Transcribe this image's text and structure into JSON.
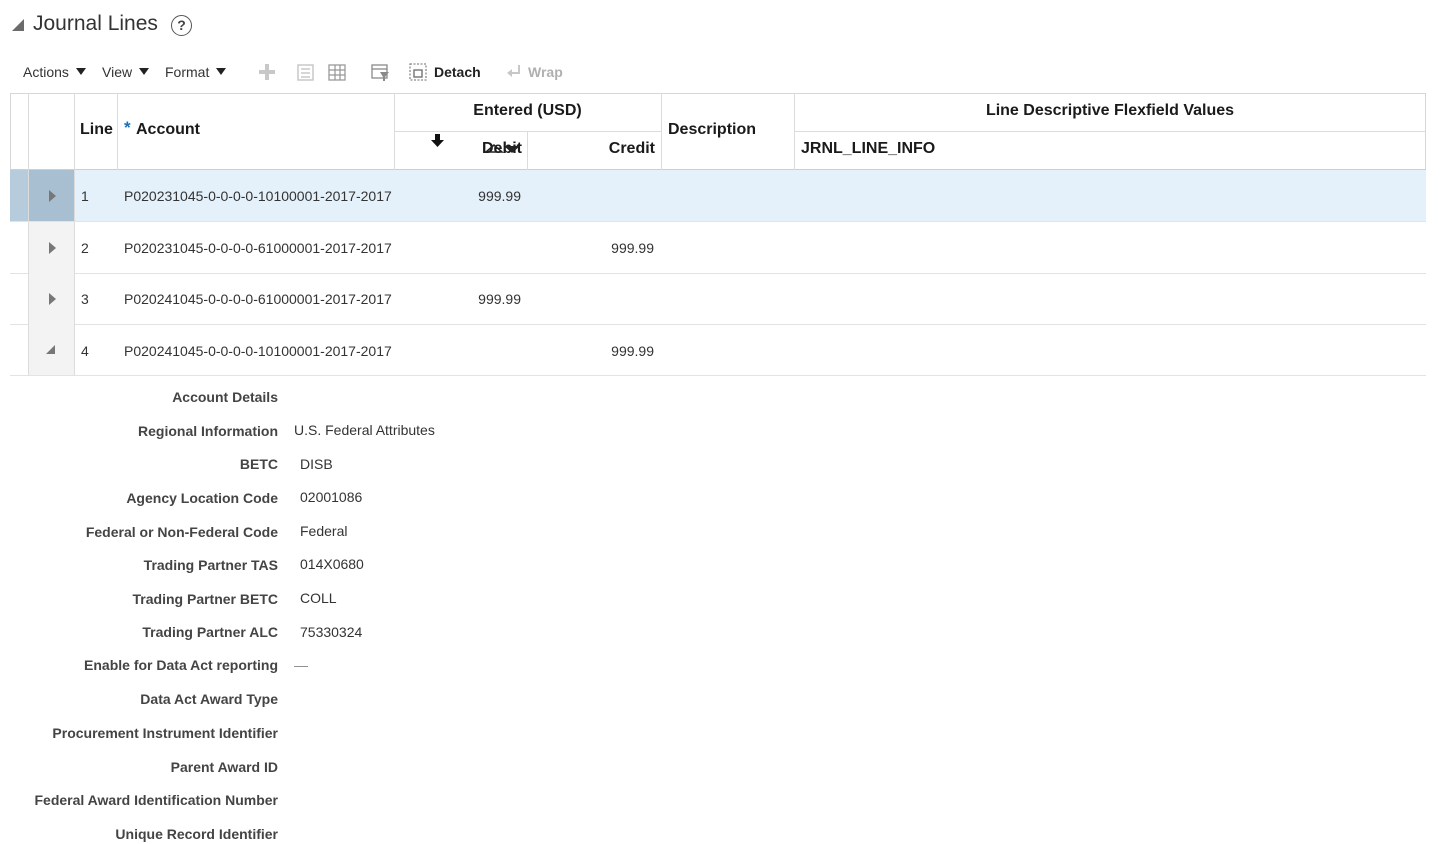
{
  "section": {
    "title": "Journal Lines",
    "help_symbol": "?"
  },
  "toolbar": {
    "actions_label": "Actions",
    "view_label": "View",
    "format_label": "Format",
    "detach_label": "Detach",
    "wrap_label": "Wrap"
  },
  "columns": {
    "line": "Line",
    "account_required_marker": "*",
    "account": "Account",
    "entered_group": "Entered (USD)",
    "debit": "Debit",
    "credit": "Credit",
    "description": "Description",
    "flex_group": "Line Descriptive Flexfield Values",
    "jrnl_line_info": "JRNL_LINE_INFO"
  },
  "rows": [
    {
      "line": "1",
      "account": "P020231045-0-0-0-0-10100001-2017-2017",
      "debit": "999.99",
      "credit": ""
    },
    {
      "line": "2",
      "account": "P020231045-0-0-0-0-61000001-2017-2017",
      "debit": "",
      "credit": "999.99"
    },
    {
      "line": "3",
      "account": "P020241045-0-0-0-0-61000001-2017-2017",
      "debit": "999.99",
      "credit": ""
    },
    {
      "line": "4",
      "account": "P020241045-0-0-0-0-10100001-2017-2017",
      "debit": "",
      "credit": "999.99"
    }
  ],
  "details": {
    "account_details_label": "Account Details",
    "regional_information_label": "Regional Information",
    "regional_information_value": "U.S. Federal Attributes",
    "betc_label": "BETC",
    "betc_value": "DISB",
    "agency_location_code_label": "Agency Location Code",
    "agency_location_code_value": "02001086",
    "federal_code_label": "Federal or Non-Federal Code",
    "federal_code_value": "Federal",
    "trading_partner_tas_label": "Trading Partner TAS",
    "trading_partner_tas_value": "014X0680",
    "trading_partner_betc_label": "Trading Partner BETC",
    "trading_partner_betc_value": "COLL",
    "trading_partner_alc_label": "Trading Partner ALC",
    "trading_partner_alc_value": "75330324",
    "data_act_reporting_label": "Enable for Data Act reporting",
    "data_act_reporting_value": "—",
    "data_act_award_type_label": "Data Act Award Type",
    "procurement_instrument_label": "Procurement Instrument Identifier",
    "parent_award_id_label": "Parent Award ID",
    "fain_label": "Federal Award Identification Number",
    "unique_record_label": "Unique Record Identifier"
  }
}
